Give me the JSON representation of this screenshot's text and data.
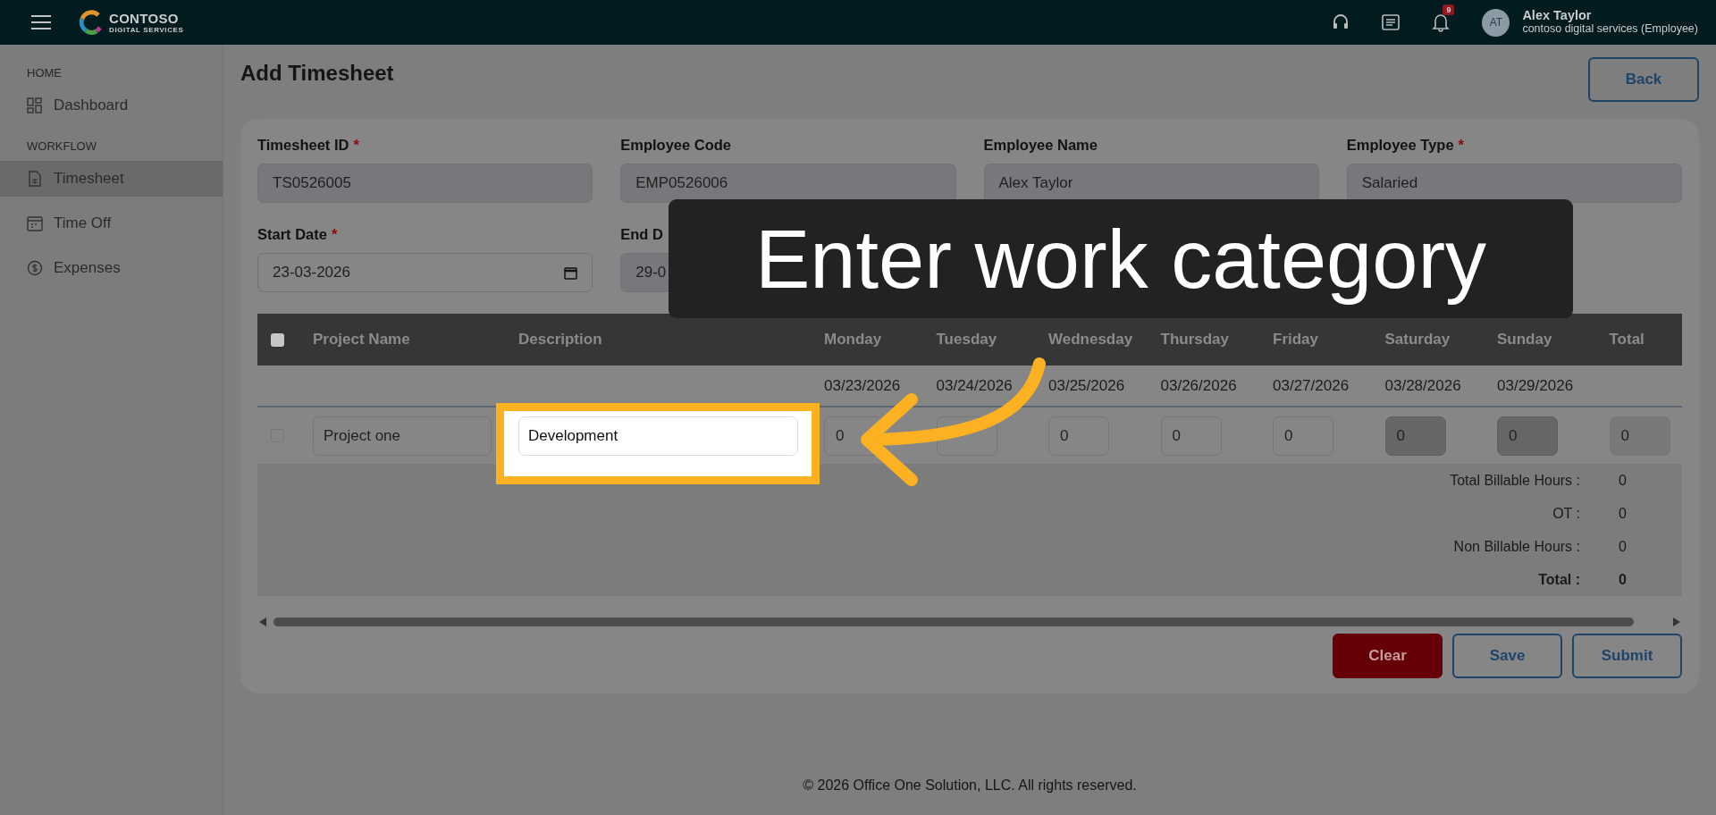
{
  "header": {
    "brand": "CONTOSO",
    "brand_sub": "DIGITAL SERVICES",
    "notification_count": "9",
    "user": {
      "initials": "AT",
      "name": "Alex Taylor",
      "org": "contoso digital services (Employee)"
    }
  },
  "sidebar": {
    "sections": [
      {
        "heading": "HOME",
        "items": [
          {
            "label": "Dashboard",
            "selected": false
          }
        ]
      },
      {
        "heading": "WORKFLOW",
        "items": [
          {
            "label": "Timesheet",
            "selected": true
          },
          {
            "label": "Time Off",
            "selected": false
          },
          {
            "label": "Expenses",
            "selected": false
          }
        ]
      }
    ]
  },
  "page": {
    "title": "Add Timesheet",
    "back_button": "Back"
  },
  "form": {
    "fields": [
      {
        "kind": "text",
        "label": "Timesheet ID",
        "required_mark": "*",
        "value": "TS0526005"
      },
      {
        "kind": "text",
        "label": "Employee Code",
        "value": "EMP0526006"
      },
      {
        "kind": "text",
        "label": "Employee Name",
        "value": "Alex Taylor"
      },
      {
        "kind": "text",
        "label": "Employee Type",
        "required_mark": "*",
        "value": "Salaried"
      },
      {
        "kind": "date",
        "label": "Start Date",
        "required_mark": "*",
        "value": "23-03-2026"
      },
      {
        "kind": "text",
        "label": "End D",
        "value": "29-0"
      }
    ]
  },
  "table": {
    "header_checked": false,
    "columns": [
      {
        "label": "Project Name"
      },
      {
        "label": "Description"
      },
      {
        "label": "Monday",
        "date": "03/23/2026"
      },
      {
        "label": "Tuesday",
        "date": "03/24/2026"
      },
      {
        "label": "Wednesday",
        "date": "03/25/2026"
      },
      {
        "label": "Thursday",
        "date": "03/26/2026"
      },
      {
        "label": "Friday",
        "date": "03/27/2026"
      },
      {
        "label": "Saturday",
        "date": "03/28/2026"
      },
      {
        "label": "Sunday",
        "date": "03/29/2026"
      },
      {
        "label": "Total"
      }
    ],
    "rows": [
      {
        "checked": false,
        "project": "Project one",
        "description": "Development",
        "highlighted": true,
        "hours": [
          {
            "value": "0",
            "disabled": false
          },
          {
            "disabled": false
          },
          {
            "value": "0",
            "disabled": false
          },
          {
            "value": "0",
            "disabled": false
          },
          {
            "value": "0",
            "disabled": false
          },
          {
            "value": "0",
            "disabled": true
          },
          {
            "value": "0",
            "disabled": true
          }
        ],
        "total": "0"
      }
    ],
    "summary": [
      {
        "label": "Total Billable Hours :",
        "value": "0",
        "bold": false
      },
      {
        "label": "OT :",
        "value": "0",
        "bold": false
      },
      {
        "label": "Non Billable Hours :",
        "value": "0",
        "bold": false
      },
      {
        "label": "Total :",
        "value": "0",
        "bold": true
      }
    ]
  },
  "buttons": [
    {
      "label": "Clear",
      "kind": "danger"
    },
    {
      "label": "Save",
      "kind": "outline"
    },
    {
      "label": "Submit",
      "kind": "outline"
    }
  ],
  "footer": "© 2026 Office One Solution, LLC. All rights reserved.",
  "callout": {
    "text": "Enter work category"
  }
}
